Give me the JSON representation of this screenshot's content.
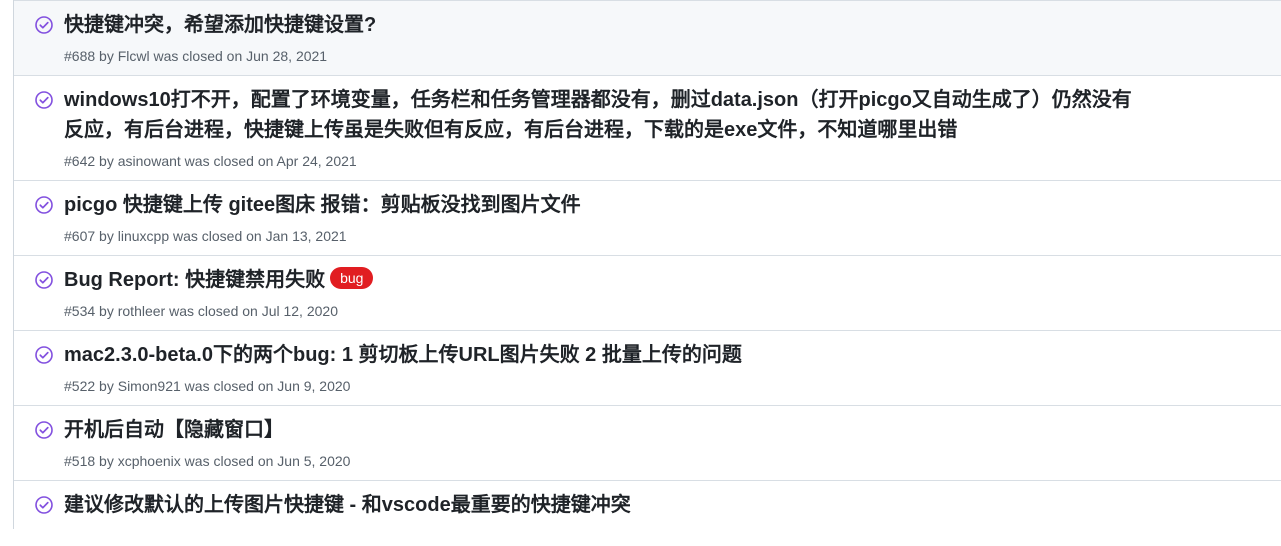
{
  "colors": {
    "closed_icon": "#8250df",
    "bug_label": "#e11d21"
  },
  "issues": [
    {
      "title": "快捷键冲突，希望添加快捷键设置?",
      "number": "#688",
      "by": "by",
      "author": "Flcwl",
      "status_text": "was closed on",
      "date": "Jun 28, 2021",
      "icon": "issue-closed-icon"
    },
    {
      "title": "windows10打不开，配置了环境变量，任务栏和任务管理器都没有，删过data.json（打开picgo又自动生成了）仍然没有反应，有后台进程，快捷键上传虽是失败但有反应，有后台进程，下载的是exe文件，不知道哪里出错",
      "number": "#642",
      "by": "by",
      "author": "asinowant",
      "status_text": "was closed on",
      "date": "Apr 24, 2021",
      "icon": "issue-closed-icon"
    },
    {
      "title": "picgo 快捷键上传 gitee图床 报错：剪贴板没找到图片文件",
      "number": "#607",
      "by": "by",
      "author": "linuxcpp",
      "status_text": "was closed on",
      "date": "Jan 13, 2021",
      "icon": "issue-closed-icon"
    },
    {
      "title": "Bug Report: 快捷键禁用失败",
      "label": "bug",
      "number": "#534",
      "by": "by",
      "author": "rothleer",
      "status_text": "was closed on",
      "date": "Jul 12, 2020",
      "icon": "issue-closed-icon"
    },
    {
      "title": "mac2.3.0-beta.0下的两个bug: 1 剪切板上传URL图片失败 2 批量上传的问题",
      "number": "#522",
      "by": "by",
      "author": "Simon921",
      "status_text": "was closed on",
      "date": "Jun 9, 2020",
      "icon": "issue-closed-icon"
    },
    {
      "title": "开机后自动【隐藏窗口】",
      "number": "#518",
      "by": "by",
      "author": "xcphoenix",
      "status_text": "was closed on",
      "date": "Jun 5, 2020",
      "icon": "issue-closed-icon"
    },
    {
      "title": "建议修改默认的上传图片快捷键 - 和vscode最重要的快捷键冲突",
      "icon": "issue-closed-icon"
    }
  ]
}
